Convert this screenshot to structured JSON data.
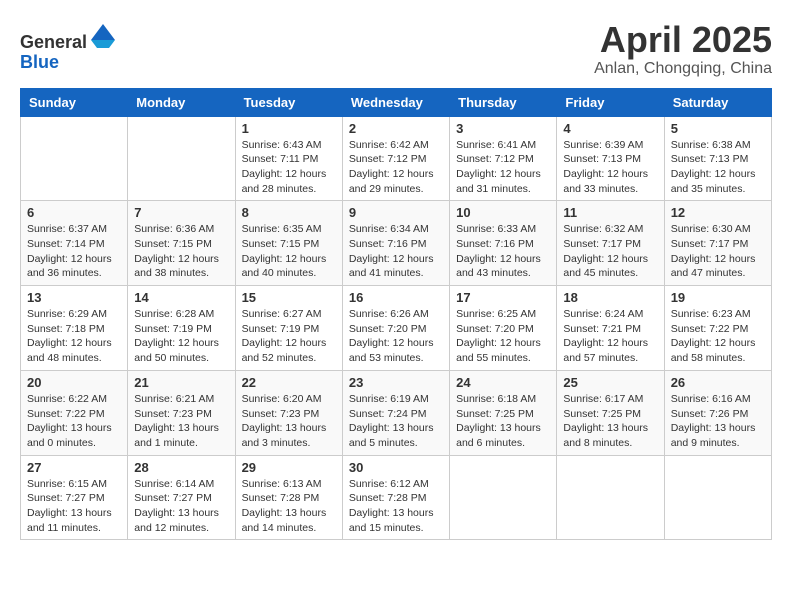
{
  "header": {
    "logo_general": "General",
    "logo_blue": "Blue",
    "month": "April 2025",
    "location": "Anlan, Chongqing, China"
  },
  "days_of_week": [
    "Sunday",
    "Monday",
    "Tuesday",
    "Wednesday",
    "Thursday",
    "Friday",
    "Saturday"
  ],
  "weeks": [
    [
      {
        "day": "",
        "info": ""
      },
      {
        "day": "",
        "info": ""
      },
      {
        "day": "1",
        "info": "Sunrise: 6:43 AM\nSunset: 7:11 PM\nDaylight: 12 hours and 28 minutes."
      },
      {
        "day": "2",
        "info": "Sunrise: 6:42 AM\nSunset: 7:12 PM\nDaylight: 12 hours and 29 minutes."
      },
      {
        "day": "3",
        "info": "Sunrise: 6:41 AM\nSunset: 7:12 PM\nDaylight: 12 hours and 31 minutes."
      },
      {
        "day": "4",
        "info": "Sunrise: 6:39 AM\nSunset: 7:13 PM\nDaylight: 12 hours and 33 minutes."
      },
      {
        "day": "5",
        "info": "Sunrise: 6:38 AM\nSunset: 7:13 PM\nDaylight: 12 hours and 35 minutes."
      }
    ],
    [
      {
        "day": "6",
        "info": "Sunrise: 6:37 AM\nSunset: 7:14 PM\nDaylight: 12 hours and 36 minutes."
      },
      {
        "day": "7",
        "info": "Sunrise: 6:36 AM\nSunset: 7:15 PM\nDaylight: 12 hours and 38 minutes."
      },
      {
        "day": "8",
        "info": "Sunrise: 6:35 AM\nSunset: 7:15 PM\nDaylight: 12 hours and 40 minutes."
      },
      {
        "day": "9",
        "info": "Sunrise: 6:34 AM\nSunset: 7:16 PM\nDaylight: 12 hours and 41 minutes."
      },
      {
        "day": "10",
        "info": "Sunrise: 6:33 AM\nSunset: 7:16 PM\nDaylight: 12 hours and 43 minutes."
      },
      {
        "day": "11",
        "info": "Sunrise: 6:32 AM\nSunset: 7:17 PM\nDaylight: 12 hours and 45 minutes."
      },
      {
        "day": "12",
        "info": "Sunrise: 6:30 AM\nSunset: 7:17 PM\nDaylight: 12 hours and 47 minutes."
      }
    ],
    [
      {
        "day": "13",
        "info": "Sunrise: 6:29 AM\nSunset: 7:18 PM\nDaylight: 12 hours and 48 minutes."
      },
      {
        "day": "14",
        "info": "Sunrise: 6:28 AM\nSunset: 7:19 PM\nDaylight: 12 hours and 50 minutes."
      },
      {
        "day": "15",
        "info": "Sunrise: 6:27 AM\nSunset: 7:19 PM\nDaylight: 12 hours and 52 minutes."
      },
      {
        "day": "16",
        "info": "Sunrise: 6:26 AM\nSunset: 7:20 PM\nDaylight: 12 hours and 53 minutes."
      },
      {
        "day": "17",
        "info": "Sunrise: 6:25 AM\nSunset: 7:20 PM\nDaylight: 12 hours and 55 minutes."
      },
      {
        "day": "18",
        "info": "Sunrise: 6:24 AM\nSunset: 7:21 PM\nDaylight: 12 hours and 57 minutes."
      },
      {
        "day": "19",
        "info": "Sunrise: 6:23 AM\nSunset: 7:22 PM\nDaylight: 12 hours and 58 minutes."
      }
    ],
    [
      {
        "day": "20",
        "info": "Sunrise: 6:22 AM\nSunset: 7:22 PM\nDaylight: 13 hours and 0 minutes."
      },
      {
        "day": "21",
        "info": "Sunrise: 6:21 AM\nSunset: 7:23 PM\nDaylight: 13 hours and 1 minute."
      },
      {
        "day": "22",
        "info": "Sunrise: 6:20 AM\nSunset: 7:23 PM\nDaylight: 13 hours and 3 minutes."
      },
      {
        "day": "23",
        "info": "Sunrise: 6:19 AM\nSunset: 7:24 PM\nDaylight: 13 hours and 5 minutes."
      },
      {
        "day": "24",
        "info": "Sunrise: 6:18 AM\nSunset: 7:25 PM\nDaylight: 13 hours and 6 minutes."
      },
      {
        "day": "25",
        "info": "Sunrise: 6:17 AM\nSunset: 7:25 PM\nDaylight: 13 hours and 8 minutes."
      },
      {
        "day": "26",
        "info": "Sunrise: 6:16 AM\nSunset: 7:26 PM\nDaylight: 13 hours and 9 minutes."
      }
    ],
    [
      {
        "day": "27",
        "info": "Sunrise: 6:15 AM\nSunset: 7:27 PM\nDaylight: 13 hours and 11 minutes."
      },
      {
        "day": "28",
        "info": "Sunrise: 6:14 AM\nSunset: 7:27 PM\nDaylight: 13 hours and 12 minutes."
      },
      {
        "day": "29",
        "info": "Sunrise: 6:13 AM\nSunset: 7:28 PM\nDaylight: 13 hours and 14 minutes."
      },
      {
        "day": "30",
        "info": "Sunrise: 6:12 AM\nSunset: 7:28 PM\nDaylight: 13 hours and 15 minutes."
      },
      {
        "day": "",
        "info": ""
      },
      {
        "day": "",
        "info": ""
      },
      {
        "day": "",
        "info": ""
      }
    ]
  ]
}
